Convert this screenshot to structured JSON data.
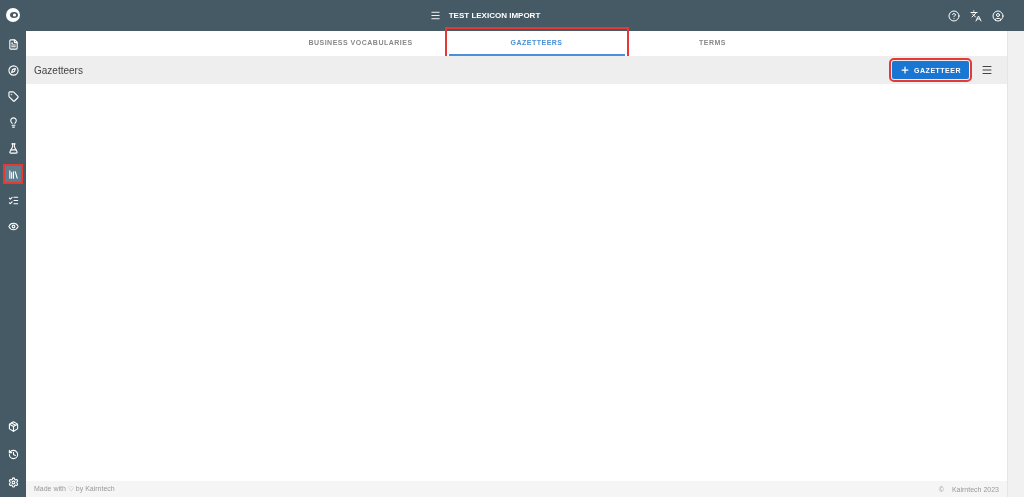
{
  "header": {
    "title": "TEST LEXICON IMPORT"
  },
  "sidebar": {
    "items": [
      {
        "highlighted": false
      },
      {
        "highlighted": false
      },
      {
        "highlighted": false
      },
      {
        "highlighted": false
      },
      {
        "highlighted": false
      },
      {
        "highlighted": true
      },
      {
        "highlighted": false
      },
      {
        "highlighted": false
      }
    ]
  },
  "tabs": [
    {
      "label": "BUSINESS VOCABULARIES",
      "selected": false,
      "highlighted": false
    },
    {
      "label": "GAZETTEERS",
      "selected": true,
      "highlighted": true
    },
    {
      "label": "TERMS",
      "selected": false,
      "highlighted": false
    }
  ],
  "toolbar": {
    "title": "Gazetteers",
    "add_button": {
      "label": "GAZETTEER",
      "highlighted": true
    }
  },
  "footer": {
    "left": "Made with ♡ by Kairntech",
    "copyright": "©",
    "right": "Kairntech 2023"
  }
}
